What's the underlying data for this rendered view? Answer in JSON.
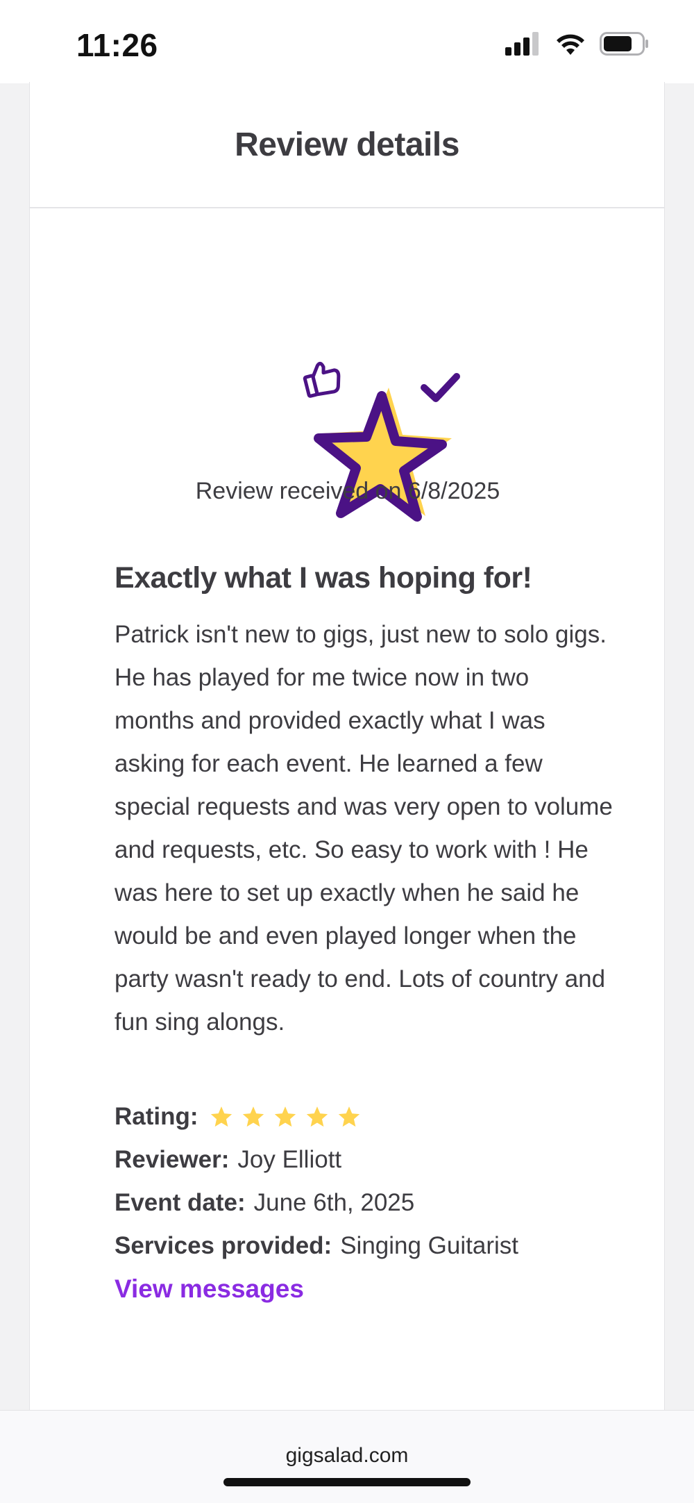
{
  "status_bar": {
    "time": "11:26"
  },
  "card": {
    "title": "Review details"
  },
  "review": {
    "received": "Review received on 6/8/2025",
    "title": "Exactly what I was hoping for!",
    "body": "Patrick isn't new to gigs, just new to solo gigs. He has played for me twice now in two months and provided exactly what I was asking for each event. He learned a few special requests and was very open to volume and requests, etc. So easy to work with ! He was here to set up exactly when he said he would be and even played longer when the party wasn't ready to end. Lots of country and fun sing alongs."
  },
  "meta": {
    "rating_label": "Rating:",
    "rating_value": 5,
    "rating_max": 5,
    "reviewer_label": "Reviewer:",
    "reviewer_value": "Joy Elliott",
    "event_date_label": "Event date:",
    "event_date_value": "June 6th, 2025",
    "services_label": "Services provided:",
    "services_value": "Singing Guitarist",
    "view_messages": "View messages"
  },
  "browser": {
    "url": "gigsalad.com"
  },
  "colors": {
    "accent": "#8a2be2",
    "star": "#ffd34e",
    "star_outline": "#4b1285"
  },
  "icons": [
    "signal-icon",
    "wifi-icon",
    "battery-icon",
    "thumbs-up-icon",
    "checkmark-icon",
    "star-illustration",
    "rating-star-icon"
  ]
}
